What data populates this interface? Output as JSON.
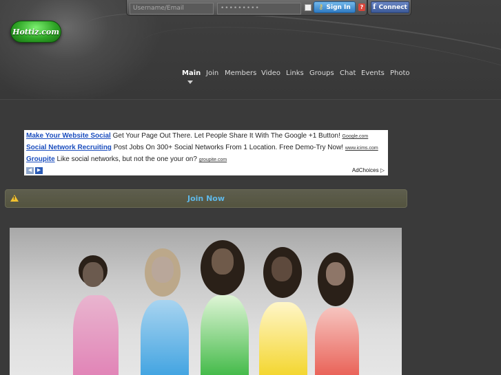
{
  "login": {
    "username_placeholder": "Username/Email",
    "password_placeholder": "•••••••••",
    "signin_label": "Sign In",
    "help_label": "?",
    "facebook_label": "Connect"
  },
  "logo": {
    "text": "Hottiz.com"
  },
  "nav": {
    "items": [
      "Main",
      "Join",
      "Members",
      "Video",
      "Links",
      "Groups",
      "Chat",
      "Events",
      "Photo"
    ],
    "active": "Main"
  },
  "ads": {
    "items": [
      {
        "title": "Make Your Website Social",
        "text": "Get Your Page Out There. Let People Share It With The Google +1 Button!",
        "url": "Google.com"
      },
      {
        "title": "Social Network Recruiting",
        "text": "Post Jobs On 300+ Social Networks From 1 Location. Free Demo-Try Now!",
        "url": "www.icims.com"
      },
      {
        "title": "Groupite",
        "text": "Like social networks, but not the one your on?",
        "url": "groupite.com"
      }
    ],
    "adchoices": "AdChoices"
  },
  "join": {
    "label": "Join Now"
  },
  "icons": {
    "warning": "warning-icon",
    "key": "key-icon",
    "facebook": "facebook-icon"
  },
  "colors": {
    "accent_blue": "#5fb8e8",
    "logo_green": "#2fa526",
    "facebook": "#3b5998"
  }
}
